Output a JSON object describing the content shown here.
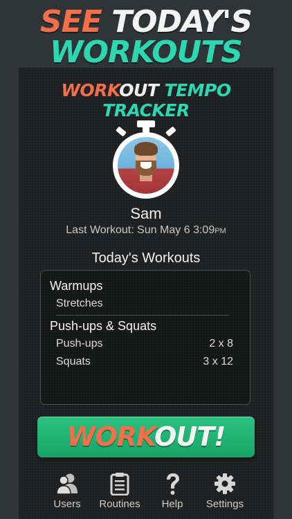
{
  "promo": {
    "line1_a": "SEE",
    "line1_b": "TODAY'S",
    "line2": "WORKOUTS"
  },
  "app_title": {
    "part1": "WORK",
    "part2": "OUT",
    "part3": "TEMPO TRACKER"
  },
  "profile": {
    "name": "Sam",
    "last_workout_label": "Last Workout: Sun May 6 3:09",
    "last_workout_ampm": "PM"
  },
  "todays_workouts": {
    "title": "Today's Workouts",
    "groups": [
      {
        "name": "Warmups",
        "items": [
          {
            "name": "Stretches",
            "reps": ""
          }
        ]
      },
      {
        "name": "Push-ups & Squats",
        "items": [
          {
            "name": "Push-ups",
            "reps": "2 x 8"
          },
          {
            "name": "Squats",
            "reps": "3 x 12"
          }
        ]
      }
    ]
  },
  "workout_button": {
    "part1": "WORK",
    "part2": "OUT!"
  },
  "tabbar": {
    "tabs": [
      {
        "label": "Users",
        "icon": "users-icon"
      },
      {
        "label": "Routines",
        "icon": "clipboard-icon"
      },
      {
        "label": "Help",
        "icon": "help-icon"
      },
      {
        "label": "Settings",
        "icon": "gear-icon"
      }
    ]
  },
  "colors": {
    "accent_orange": "#f26f4a",
    "accent_teal": "#2dd7b1",
    "button_green": "#1fb373"
  }
}
